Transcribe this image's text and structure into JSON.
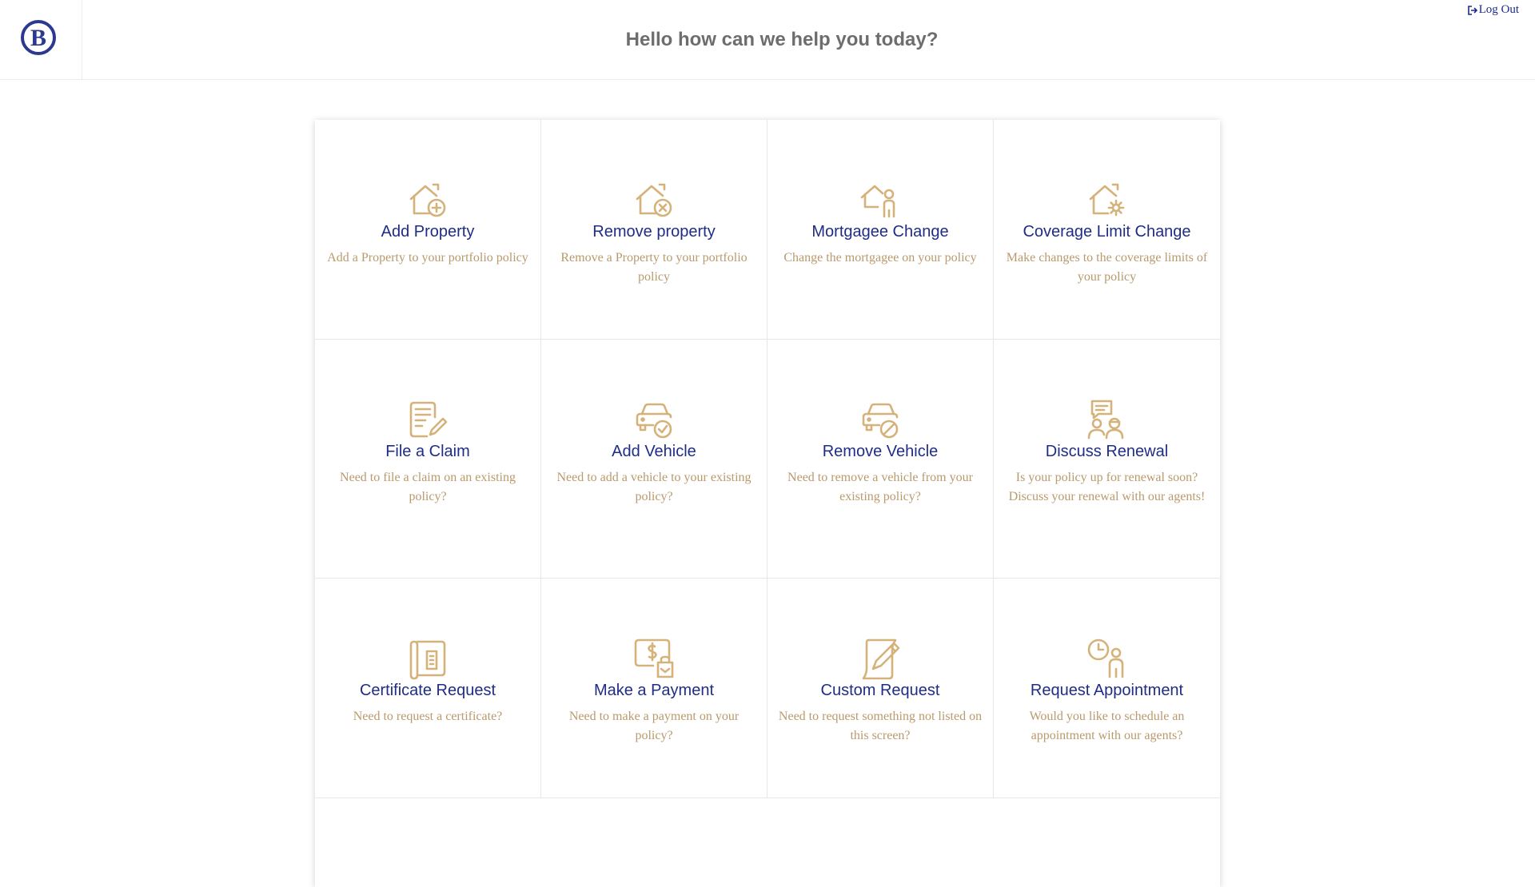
{
  "header": {
    "logo_letter": "B",
    "title": "Hello how can we help you today?",
    "logout_label": "Log Out",
    "logout_icon": "sign-out-icon"
  },
  "colors": {
    "brand": "#2b3a8f",
    "card_title": "#1f2d86",
    "card_desc": "#b99a6c",
    "icon_gold": "#d4b27a"
  },
  "cards": [
    {
      "title": "Add Property",
      "desc": "Add a Property to your portfolio policy",
      "icon": "house-plus-icon"
    },
    {
      "title": "Remove property",
      "desc": "Remove a Property to your portfolio policy",
      "icon": "house-remove-icon"
    },
    {
      "title": "Mortgagee Change",
      "desc": "Change the mortgagee on your policy",
      "icon": "house-person-icon"
    },
    {
      "title": "Coverage Limit Change",
      "desc": "Make changes to the coverage limits of your policy",
      "icon": "house-gear-icon"
    },
    {
      "title": "File a Claim",
      "desc": "Need to file a claim on an existing policy?",
      "icon": "document-pen-icon"
    },
    {
      "title": "Add Vehicle",
      "desc": "Need to add a vehicle to your existing policy?",
      "icon": "car-check-icon"
    },
    {
      "title": "Remove Vehicle",
      "desc": "Need to remove a vehicle from your existing policy?",
      "icon": "car-ban-icon"
    },
    {
      "title": "Discuss Renewal",
      "desc": "Is your policy up for renewal soon? Discuss your renewal with our agents!",
      "icon": "agents-chat-icon"
    },
    {
      "title": "Certificate Request",
      "desc": "Need to request a certificate?",
      "icon": "certificate-scroll-icon"
    },
    {
      "title": "Make a Payment",
      "desc": "Need to make a payment on your policy?",
      "icon": "payment-icon"
    },
    {
      "title": "Custom Request",
      "desc": "Need to request something not listed on this screen?",
      "icon": "note-pencil-icon"
    },
    {
      "title": "Request Appointment",
      "desc": "Would you like to schedule an appointment with our agents?",
      "icon": "clock-person-icon"
    }
  ]
}
